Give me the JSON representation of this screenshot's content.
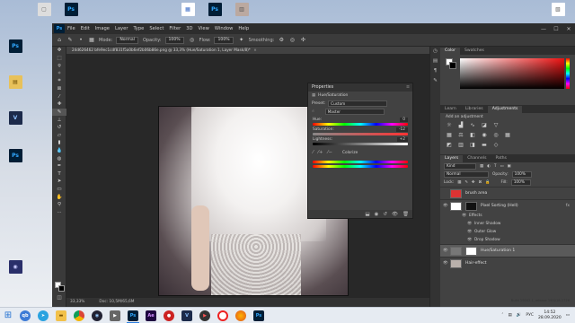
{
  "desktop": {
    "icons": [
      {
        "glyph": "▣",
        "label": "Ps",
        "id": "d1"
      },
      {
        "glyph": "▢",
        "label": "",
        "id": "d2"
      },
      {
        "glyph": "Ps",
        "label": "",
        "id": "d3"
      },
      {
        "glyph": "▤",
        "label": "",
        "id": "d4"
      },
      {
        "glyph": "Ps",
        "label": "",
        "id": "d5"
      },
      {
        "glyph": "▦",
        "label": "",
        "id": "d6"
      },
      {
        "glyph": "Ps",
        "label": "",
        "id": "d7"
      },
      {
        "glyph": "▥",
        "label": "",
        "id": "d8"
      },
      {
        "glyph": "V",
        "label": "",
        "id": "d9"
      },
      {
        "glyph": "Ps",
        "label": "",
        "id": "d10"
      },
      {
        "glyph": "◉",
        "label": "",
        "id": "d11"
      },
      {
        "glyph": "▧",
        "label": "",
        "id": "d12"
      }
    ]
  },
  "app": {
    "logo": "Ps",
    "menu": [
      "File",
      "Edit",
      "Image",
      "Layer",
      "Type",
      "Select",
      "Filter",
      "3D",
      "View",
      "Window",
      "Help"
    ],
    "window_controls": [
      "—",
      "☐",
      "✕"
    ]
  },
  "options": {
    "mode_label": "Mode:",
    "mode_value": "Normal",
    "opacity_label": "Opacity:",
    "opacity_value": "100%",
    "flow_label": "Flow:",
    "flow_value": "100%",
    "smoothing_label": "Smoothing:"
  },
  "document": {
    "tab_title": "24d626462 bfe9ec1cdf831f5a0b6ef2b06b86e.png @ 33,3% (Hue/Saturation 1, Layer Mask/8)*",
    "close": "×",
    "zoom": "33,33%",
    "doc_size": "Doc: 10,5M/65,6M"
  },
  "properties": {
    "title": "Properties",
    "subtitle": "Hue/Saturation",
    "preset_label": "Preset:",
    "preset_value": "Custom",
    "channel_value": "Master",
    "hue_label": "Hue:",
    "hue_value": "0",
    "saturation_label": "Saturation:",
    "saturation_value": "-12",
    "lightness_label": "Lightness:",
    "lightness_value": "+2",
    "colorize_label": "Colorize"
  },
  "panels": {
    "color_tabs": [
      "Color",
      "Swatches"
    ],
    "adj_tabs": [
      "Learn",
      "Libraries",
      "Adjustments"
    ],
    "add_adjustment": "Add an adjustment",
    "layers_tabs": [
      "Layers",
      "Channels",
      "Paths"
    ],
    "kind_label": "Kind",
    "blend_mode": "Normal",
    "opacity_label": "Opacity:",
    "opacity_value": "100%",
    "lock_label": "Lock:",
    "fill_label": "Fill:",
    "fill_value": "100%"
  },
  "layers": [
    {
      "name": "brush area",
      "thumb": "#dd3333",
      "mask": false,
      "fx": false,
      "selected": false
    },
    {
      "name": "Pixel Sorting (Hell)",
      "thumb": "#222222",
      "mask": true,
      "fx": true,
      "selected": false
    },
    {
      "name": "Hue/Saturation 1",
      "thumb": "#666666",
      "mask": true,
      "fx": false,
      "selected": true
    },
    {
      "name": "Hair-effect",
      "thumb": "#b9b0ab",
      "mask": false,
      "fx": false,
      "selected": false
    }
  ],
  "effects": {
    "label": "Effects",
    "items": [
      "Inner Shadow",
      "Outer Glow",
      "Drop Shadow"
    ]
  },
  "taskbar": {
    "lang": "РУС",
    "time": "14:52",
    "date": "28.09.2020",
    "build_line1": "Build 19042.1_release 190218-1726",
    "build_line2": "Windows 10 Pro"
  },
  "colors": {
    "accent": "#31a8ff",
    "panel_bg": "#424242",
    "canvas_bg": "#282828"
  }
}
